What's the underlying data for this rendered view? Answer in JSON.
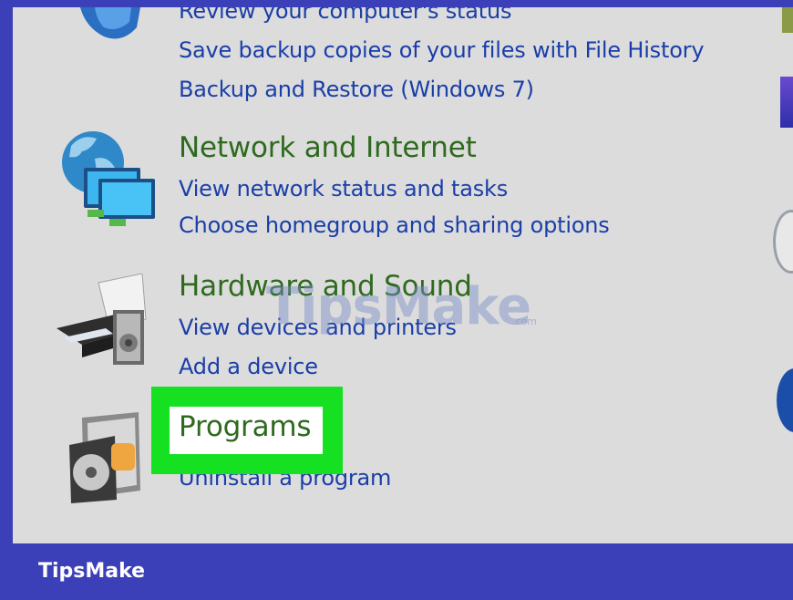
{
  "categories": [
    {
      "links": [
        "Review your computer's status",
        "Save backup copies of your files with File History",
        "Backup and Restore (Windows 7)"
      ]
    },
    {
      "title": "Network and Internet",
      "links": [
        "View network status and tasks",
        "Choose homegroup and sharing options"
      ]
    },
    {
      "title": "Hardware and Sound",
      "links": [
        "View devices and printers",
        "Add a device"
      ]
    },
    {
      "title": "Programs",
      "links": [
        "Uninstall a program"
      ]
    }
  ],
  "watermark": {
    "brand": "TipsMake",
    "domain": ".com"
  },
  "footer": {
    "brand": "TipsMake"
  },
  "colors": {
    "border": "#3b40b8",
    "highlight": "#15e021",
    "link": "#1a3ea8",
    "heading": "#2e6a1e"
  }
}
